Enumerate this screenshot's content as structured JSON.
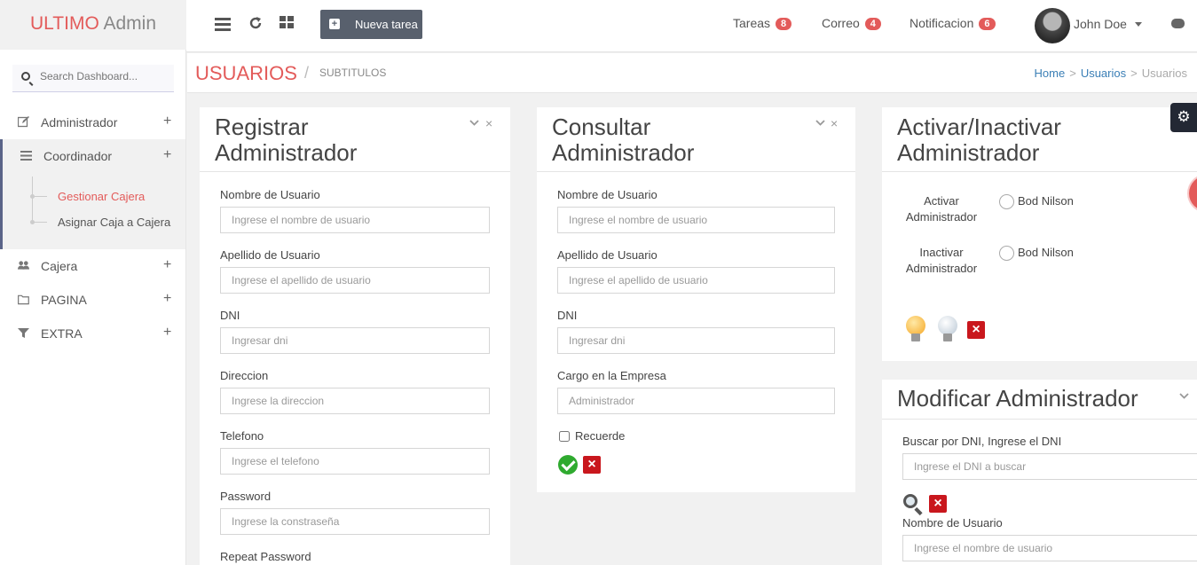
{
  "brand": {
    "accent": "ULTIMO",
    "rest": "Admin"
  },
  "topbar": {
    "new_task_label": "Nueva tarea",
    "nav": [
      {
        "label": "Tareas",
        "count": "8"
      },
      {
        "label": "Correo",
        "count": "4"
      },
      {
        "label": "Notificacion",
        "count": "6"
      }
    ],
    "user_name": "John Doe"
  },
  "sidebar": {
    "search_placeholder": "Search Dashboard...",
    "items": [
      {
        "label": "Administrador",
        "icon": "edit-icon"
      },
      {
        "label": "Coordinador",
        "icon": "list-icon"
      },
      {
        "label": "Cajera",
        "icon": "users-icon"
      },
      {
        "label": "PAGINA",
        "icon": "folder-icon"
      },
      {
        "label": "EXTRA",
        "icon": "filter-icon"
      }
    ],
    "subitems": [
      {
        "label": "Gestionar Cajera",
        "active": true
      },
      {
        "label": "Asignar Caja a Cajera",
        "active": false
      }
    ]
  },
  "page": {
    "title": "USUARIOS",
    "subtitle": "SUBTITULOS",
    "breadcrumb": [
      "Home",
      "Usuarios",
      "Usuarios"
    ]
  },
  "registrar": {
    "title_line1": "Registrar",
    "title_line2": "Administrador",
    "fields": [
      {
        "label": "Nombre de Usuario",
        "placeholder": "Ingrese el nombre de usuario"
      },
      {
        "label": "Apellido de Usuario",
        "placeholder": "Ingrese el apellido de usuario"
      },
      {
        "label": "DNI",
        "placeholder": "Ingresar dni"
      },
      {
        "label": "Direccion",
        "placeholder": "Ingrese la direccion"
      },
      {
        "label": "Telefono",
        "placeholder": "Ingrese el telefono"
      },
      {
        "label": "Password",
        "placeholder": "Ingrese la constraseña"
      },
      {
        "label": "Repeat Password",
        "placeholder": ""
      }
    ]
  },
  "consultar": {
    "title_line1": "Consultar",
    "title_line2": "Administrador",
    "fields": [
      {
        "label": "Nombre de Usuario",
        "placeholder": "Ingrese el nombre de usuario"
      },
      {
        "label": "Apellido de Usuario",
        "placeholder": "Ingrese el apellido de usuario"
      },
      {
        "label": "DNI",
        "placeholder": "Ingresar dni"
      },
      {
        "label": "Cargo en la Empresa",
        "placeholder": "Administrador"
      }
    ],
    "checkbox_label": "Recuerde"
  },
  "activar": {
    "title_line1": "Activar/Inactivar",
    "title_line2": "Administrador",
    "rows": [
      {
        "label_line1": "Activar",
        "label_line2": "Administrador",
        "option": "Bod Nilson"
      },
      {
        "label_line1": "Inactivar",
        "label_line2": "Administrador",
        "option": "Bod Nilson"
      }
    ]
  },
  "modificar": {
    "title": "Modificar Administrador",
    "search_label": "Buscar por DNI, Ingrese el DNI",
    "search_placeholder": "Ingrese el DNI a buscar",
    "field_label": "Nombre de Usuario",
    "field_placeholder": "Ingrese el nombre de usuario"
  },
  "colors": {
    "accent": "#e35b5a",
    "link": "#3b7fb6",
    "sidebar_active": "#5a6488"
  }
}
